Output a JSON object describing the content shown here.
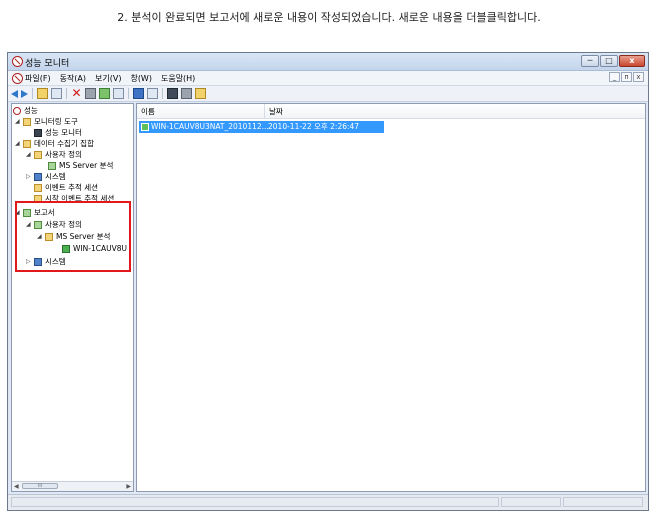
{
  "caption": "2. 분석이 완료되면 보고서에 새로운 내용이 작성되었습니다. 새로운 내용을 더블클릭합니다.",
  "window": {
    "title": "성능 모니터",
    "controls": {
      "minimize": "─",
      "maximize": "□",
      "close": "x"
    }
  },
  "menu": {
    "items": [
      "파일(F)",
      "동작(A)",
      "보기(V)",
      "창(W)",
      "도움말(H)"
    ],
    "mdi_controls": {
      "minimize": "_",
      "restore": "ᴨ",
      "close": "x"
    }
  },
  "tree": {
    "items": [
      {
        "label": "성능",
        "expander": ""
      },
      {
        "label": "모니터링 도구",
        "expander": "◢"
      },
      {
        "label": "성능 모니터",
        "expander": ""
      },
      {
        "label": "데이터 수집기 집합",
        "expander": "◢"
      },
      {
        "label": "사용자 정의",
        "expander": "◢"
      },
      {
        "label": "MS Server 분석",
        "expander": ""
      },
      {
        "label": "시스템",
        "expander": "▷"
      },
      {
        "label": "이벤트 추적 세션",
        "expander": ""
      },
      {
        "label": "시작 이벤트 추적 세션",
        "expander": ""
      },
      {
        "label": "보고서",
        "expander": "◢"
      },
      {
        "label": "사용자 정의",
        "expander": "◢"
      },
      {
        "label": "MS Server 분석",
        "expander": "◢"
      },
      {
        "label": "WIN-1CAUV8U",
        "expander": ""
      },
      {
        "label": "시스템",
        "expander": "▷"
      }
    ],
    "scroll_thumb": "III"
  },
  "list": {
    "columns": [
      "이름",
      "날짜"
    ],
    "rows": [
      {
        "name": "WIN-1CAUV8U3NAT_2010112...",
        "date": "2010-11-22 오후 2:26:47"
      }
    ]
  },
  "colors": {
    "highlight_box": "#e2191b",
    "selection": "#3399ff"
  }
}
